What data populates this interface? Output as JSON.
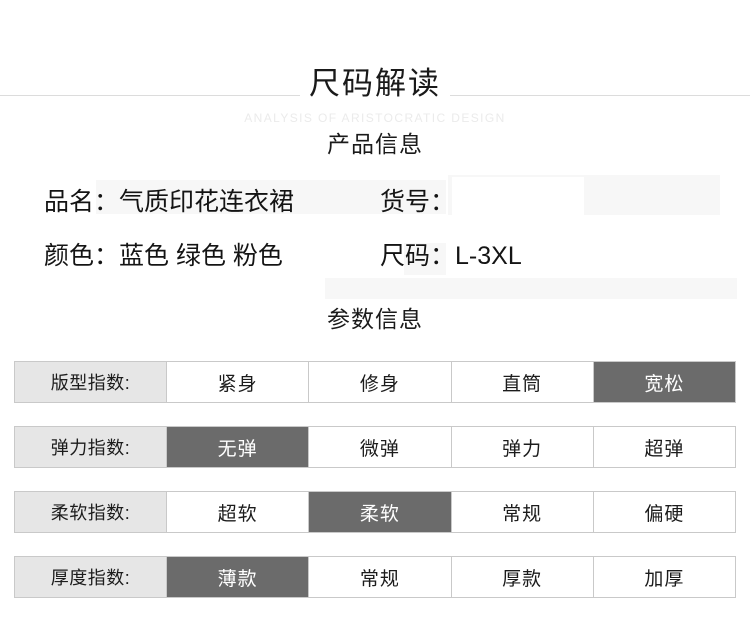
{
  "header": {
    "title": "尺码解读",
    "subtitle": "ANALYSIS OF ARISTOCRATIC DESIGN"
  },
  "sections": {
    "product_info_heading": "产品信息",
    "param_info_heading": "参数信息"
  },
  "product_info": [
    {
      "left_label": "品名：",
      "left_value": "气质印花连衣裙",
      "right_label": "货号：",
      "right_value": ""
    },
    {
      "left_label": "颜色：",
      "left_value": "蓝色 绿色 粉色",
      "right_label": "尺码：",
      "right_value": "L-3XL"
    }
  ],
  "param_table": {
    "rows": [
      {
        "label": "版型指数:",
        "options": [
          "紧身",
          "修身",
          "直筒",
          "宽松"
        ],
        "selected_index": 3
      },
      {
        "label": "弹力指数:",
        "options": [
          "无弹",
          "微弹",
          "弹力",
          "超弹"
        ],
        "selected_index": 0
      },
      {
        "label": "柔软指数:",
        "options": [
          "超软",
          "柔软",
          "常规",
          "偏硬"
        ],
        "selected_index": 1
      },
      {
        "label": "厚度指数:",
        "options": [
          "薄款",
          "常规",
          "厚款",
          "加厚"
        ],
        "selected_index": 0
      }
    ]
  },
  "colors": {
    "highlight_cell": "#6b6b6b",
    "label_cell": "#e6e6e6",
    "border": "#c9c9c9",
    "band": "#f7f7f7",
    "subtitle": "#ebebeb",
    "text": "#161616"
  }
}
